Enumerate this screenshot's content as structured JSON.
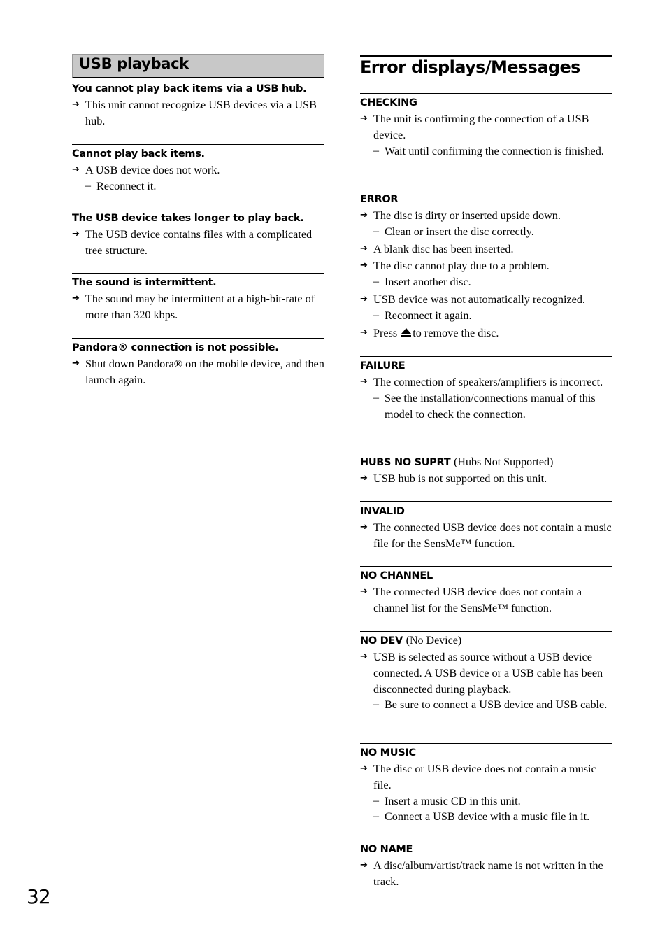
{
  "page_number": "32",
  "left": {
    "section_title": "USB playback",
    "blocks": [
      {
        "heading": "You cannot play back items via a USB hub.",
        "items": [
          {
            "type": "arrow",
            "text": "This unit cannot recognize USB devices via a USB hub."
          }
        ]
      },
      {
        "heading": "Cannot play back items.",
        "items": [
          {
            "type": "arrow",
            "text": "A USB device does not work."
          },
          {
            "type": "dash",
            "text": "Reconnect it."
          }
        ]
      },
      {
        "heading": "The USB device takes longer to play back.",
        "items": [
          {
            "type": "arrow",
            "text": "The USB device contains files with a complicated tree structure."
          }
        ]
      },
      {
        "heading": "The sound is intermittent.",
        "items": [
          {
            "type": "arrow",
            "text": "The sound may be intermittent at a high-bit-rate of more than 320 kbps."
          }
        ]
      },
      {
        "heading": "Pandora® connection is not possible.",
        "items": [
          {
            "type": "arrow",
            "text": "Shut down Pandora® on the mobile device, and then launch again."
          }
        ]
      }
    ]
  },
  "right": {
    "page_title": "Error displays/Messages",
    "blocks": [
      {
        "heading": "CHECKING",
        "sub": "",
        "items": [
          {
            "type": "arrow",
            "text": "The unit is confirming the connection of a USB device."
          },
          {
            "type": "dash",
            "text": "Wait until confirming the connection is finished."
          }
        ]
      },
      {
        "heading": "ERROR",
        "sub": "",
        "items": [
          {
            "type": "arrow",
            "text": "The disc is dirty or inserted upside down."
          },
          {
            "type": "dash",
            "text": "Clean or insert the disc correctly."
          },
          {
            "type": "arrow",
            "text": "A blank disc has been inserted."
          },
          {
            "type": "arrow",
            "text": "The disc cannot play due to a problem."
          },
          {
            "type": "dash",
            "text": "Insert another disc."
          },
          {
            "type": "arrow",
            "text": "USB device was not automatically recognized."
          },
          {
            "type": "dash",
            "text": "Reconnect it again."
          },
          {
            "type": "arrow-eject",
            "before": "Press",
            "icon": "eject-icon",
            "after": "to remove the disc."
          }
        ]
      },
      {
        "heading": "FAILURE",
        "sub": "",
        "items": [
          {
            "type": "arrow",
            "text": "The connection of speakers/amplifiers is incorrect."
          },
          {
            "type": "dash",
            "text": "See the installation/connections manual of this model to check the connection."
          }
        ]
      },
      {
        "heading": "HUBS NO SUPRT",
        "sub": "(Hubs Not Supported)",
        "items": [
          {
            "type": "arrow",
            "text": "USB hub is not supported on this unit."
          }
        ]
      },
      {
        "heading": "INVALID",
        "sub": "",
        "items": [
          {
            "type": "arrow",
            "text": "The connected USB device does not contain a music file for the SensMe™ function."
          }
        ]
      },
      {
        "heading": "NO CHANNEL",
        "sub": "",
        "items": [
          {
            "type": "arrow",
            "text": "The connected USB device does not contain a channel list for the SensMe™ function."
          }
        ]
      },
      {
        "heading": "NO DEV",
        "sub": "(No Device)",
        "items": [
          {
            "type": "arrow",
            "text": "USB is selected as source without a USB device connected. A USB device or a USB cable has been disconnected during playback."
          },
          {
            "type": "dash",
            "text": "Be sure to connect a USB device and USB cable."
          }
        ]
      },
      {
        "heading": "NO MUSIC",
        "sub": "",
        "items": [
          {
            "type": "arrow",
            "text": "The disc or USB device does not contain a music file."
          },
          {
            "type": "dash",
            "text": "Insert a music CD in this unit."
          },
          {
            "type": "dash",
            "text": "Connect a USB device with a music file in it."
          }
        ]
      },
      {
        "heading": "NO NAME",
        "sub": "",
        "items": [
          {
            "type": "arrow",
            "text": "A disc/album/artist/track name is not written in the track."
          }
        ]
      }
    ]
  }
}
